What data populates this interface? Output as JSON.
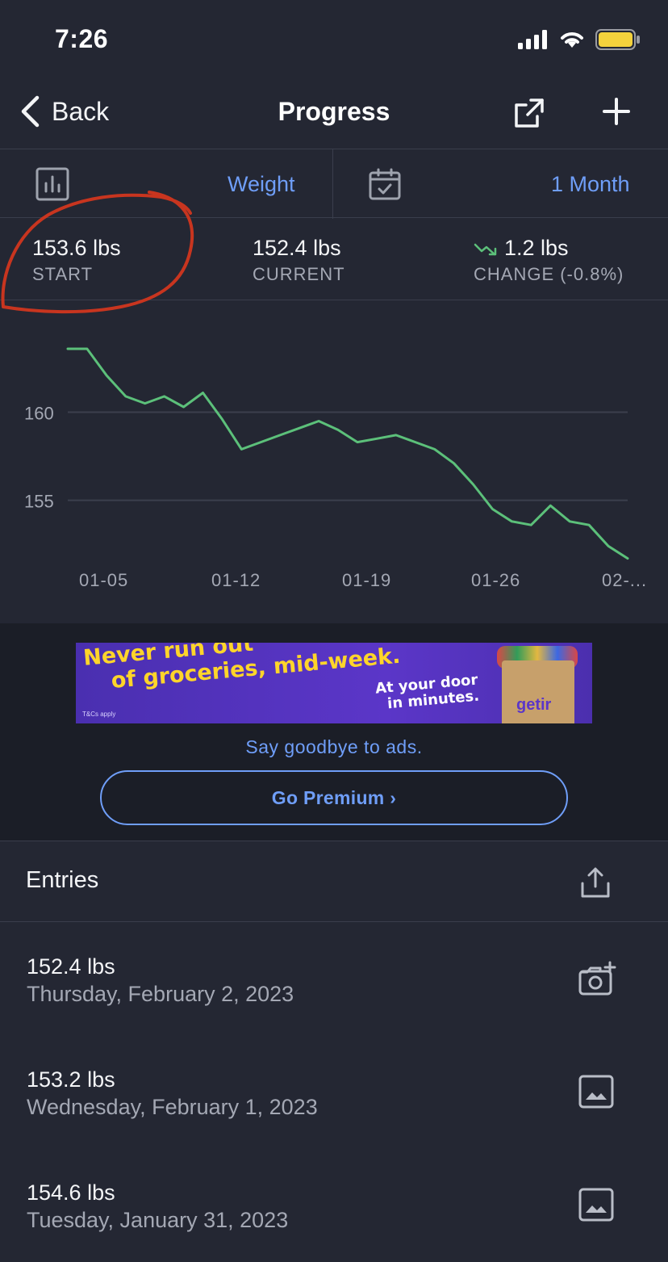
{
  "status_bar": {
    "time": "7:26"
  },
  "nav": {
    "back_label": "Back",
    "title": "Progress"
  },
  "selectors": {
    "metric": "Weight",
    "range": "1 Month"
  },
  "stats": {
    "start": {
      "value": "153.6 lbs",
      "label": "START"
    },
    "current": {
      "value": "152.4 lbs",
      "label": "CURRENT"
    },
    "change": {
      "value": "1.2 lbs",
      "label": "CHANGE (-0.8%)"
    }
  },
  "chart_data": {
    "type": "line",
    "x_tick_labels": [
      "01-05",
      "01-12",
      "01-19",
      "01-26",
      "02-..."
    ],
    "y_tick_labels": [
      "160",
      "155"
    ],
    "y_ticks": [
      160,
      155
    ],
    "ylim": [
      152.6,
      163.6
    ],
    "line_color": "#5cc07a",
    "series": [
      {
        "values": [
          163.6,
          163.6,
          162.1,
          160.9,
          160.5,
          160.9,
          160.3,
          161.1,
          159.6,
          157.9,
          158.3,
          158.7,
          159.1,
          159.5,
          159.0,
          158.3,
          158.5,
          158.7,
          158.3,
          157.9,
          157.1,
          155.9,
          154.5,
          153.8,
          153.6,
          154.7,
          153.8,
          153.6,
          152.4,
          151.7
        ]
      }
    ],
    "grid": true
  },
  "ad": {
    "headline_1": "Never run out",
    "headline_2": "of groceries, mid-week.",
    "sub_1": "At your door",
    "sub_2": "in minutes.",
    "tc": "T&Cs apply",
    "brand": "getir",
    "goodbye": "Say goodbye to ads.",
    "premium_label": "Go Premium ›"
  },
  "entries": {
    "title": "Entries",
    "items": [
      {
        "weight": "152.4 lbs",
        "date": "Thursday, February 2, 2023",
        "icon": "add-photo-icon"
      },
      {
        "weight": "153.2 lbs",
        "date": "Wednesday, February 1, 2023",
        "icon": "photo-icon"
      },
      {
        "weight": "154.6 lbs",
        "date": "Tuesday, January 31, 2023",
        "icon": "photo-icon"
      }
    ]
  },
  "colors": {
    "background": "#242733",
    "accent": "#6f9ef8",
    "line": "#5cc07a",
    "annotation": "#c8351f"
  }
}
